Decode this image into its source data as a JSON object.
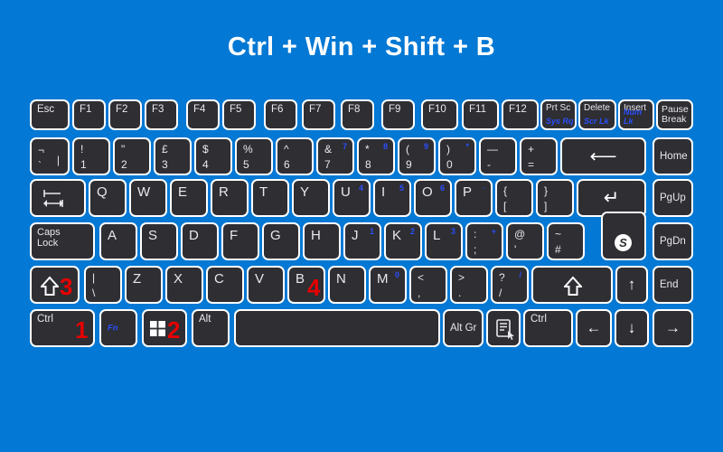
{
  "title": "Ctrl + Win + Shift + B",
  "colors": {
    "background": "#0378d4",
    "key_face": "#2e2e33",
    "key_border": "#ffffff",
    "legend": "#e9e9ec",
    "secondary_legend": "#2b4ffd",
    "step_marker": "#e60000"
  },
  "steps": [
    {
      "number": "1",
      "key": "Ctrl"
    },
    {
      "number": "2",
      "key": "Win"
    },
    {
      "number": "3",
      "key": "Shift"
    },
    {
      "number": "4",
      "key": "B"
    }
  ],
  "rows": {
    "function_row": [
      {
        "label": "Esc"
      },
      {
        "label": "F1"
      },
      {
        "label": "F2"
      },
      {
        "label": "F3"
      },
      {
        "label": "F4"
      },
      {
        "label": "F5"
      },
      {
        "label": "F6"
      },
      {
        "label": "F7"
      },
      {
        "label": "F8"
      },
      {
        "label": "F9"
      },
      {
        "label": "F10"
      },
      {
        "label": "F11"
      },
      {
        "label": "F12"
      },
      {
        "label": "Prt Sc",
        "sub": "Sys Rq"
      },
      {
        "label": "Delete",
        "sub": "Scr Lk"
      },
      {
        "label": "Insert",
        "sub": "Num Lk"
      },
      {
        "label": "Pause\nBreak"
      }
    ],
    "number_row": [
      {
        "top": "¬",
        "bottom": "`",
        "extra": "|"
      },
      {
        "top": "!",
        "bottom": "1"
      },
      {
        "top": "\"",
        "bottom": "2"
      },
      {
        "top": "£",
        "bottom": "3"
      },
      {
        "top": "$",
        "bottom": "4"
      },
      {
        "top": "%",
        "bottom": "5"
      },
      {
        "top": "^",
        "bottom": "6"
      },
      {
        "top": "&",
        "bottom": "7",
        "numpad": "7"
      },
      {
        "top": "*",
        "bottom": "8",
        "numpad": "8"
      },
      {
        "top": "(",
        "bottom": "9",
        "numpad": "9"
      },
      {
        "top": ")",
        "bottom": "0",
        "numpad": "*"
      },
      {
        "top": "—",
        "bottom": "-"
      },
      {
        "top": "+",
        "bottom": "="
      },
      {
        "label": "backspace-arrow",
        "glyph": "⟵"
      },
      {
        "label": "Home"
      }
    ],
    "top_row": [
      {
        "label": "tab-arrows"
      },
      {
        "label": "Q"
      },
      {
        "label": "W"
      },
      {
        "label": "E"
      },
      {
        "label": "R"
      },
      {
        "label": "T"
      },
      {
        "label": "Y"
      },
      {
        "label": "U",
        "numpad": "4"
      },
      {
        "label": "I",
        "numpad": "5"
      },
      {
        "label": "O",
        "numpad": "6"
      },
      {
        "label": "P",
        "numpad": "-"
      },
      {
        "top": "{",
        "bottom": "["
      },
      {
        "top": "}",
        "bottom": "]"
      },
      {
        "label": "Enter",
        "glyph": "↵"
      },
      {
        "label": "PgUp"
      }
    ],
    "home_row": [
      {
        "label": "Caps\nLock"
      },
      {
        "label": "A"
      },
      {
        "label": "S"
      },
      {
        "label": "D"
      },
      {
        "label": "F"
      },
      {
        "label": "G"
      },
      {
        "label": "H"
      },
      {
        "label": "J",
        "numpad": "1"
      },
      {
        "label": "K",
        "numpad": "2"
      },
      {
        "label": "L",
        "numpad": "3"
      },
      {
        "top": ":",
        "bottom": ";",
        "numpad": "+"
      },
      {
        "top": "@",
        "bottom": "'"
      },
      {
        "top": "~",
        "bottom": "#"
      },
      {
        "label": "PgDn"
      }
    ],
    "shift_row": [
      {
        "label": "Shift",
        "glyph": "⇧",
        "step": "3"
      },
      {
        "top": "|",
        "bottom": "\\"
      },
      {
        "label": "Z"
      },
      {
        "label": "X"
      },
      {
        "label": "C"
      },
      {
        "label": "V"
      },
      {
        "label": "B",
        "step": "4"
      },
      {
        "label": "N"
      },
      {
        "label": "M",
        "numpad": "0"
      },
      {
        "top": "<",
        "bottom": ","
      },
      {
        "top": ">",
        "bottom": "."
      },
      {
        "top": "?",
        "bottom": "/",
        "numpad": "/"
      },
      {
        "label": "Shift",
        "glyph": "⇧"
      },
      {
        "label": "up-arrow",
        "glyph": "↑"
      },
      {
        "label": "End"
      }
    ],
    "bottom_row": [
      {
        "label": "Ctrl",
        "step": "1"
      },
      {
        "label": "Fn"
      },
      {
        "label": "Win",
        "step": "2"
      },
      {
        "label": "Alt"
      },
      {
        "label": "Space"
      },
      {
        "label": "Alt Gr"
      },
      {
        "label": "Menu"
      },
      {
        "label": "Ctrl"
      },
      {
        "label": "left-arrow",
        "glyph": "←"
      },
      {
        "label": "down-arrow",
        "glyph": "↓"
      },
      {
        "label": "right-arrow",
        "glyph": "→"
      }
    ]
  }
}
